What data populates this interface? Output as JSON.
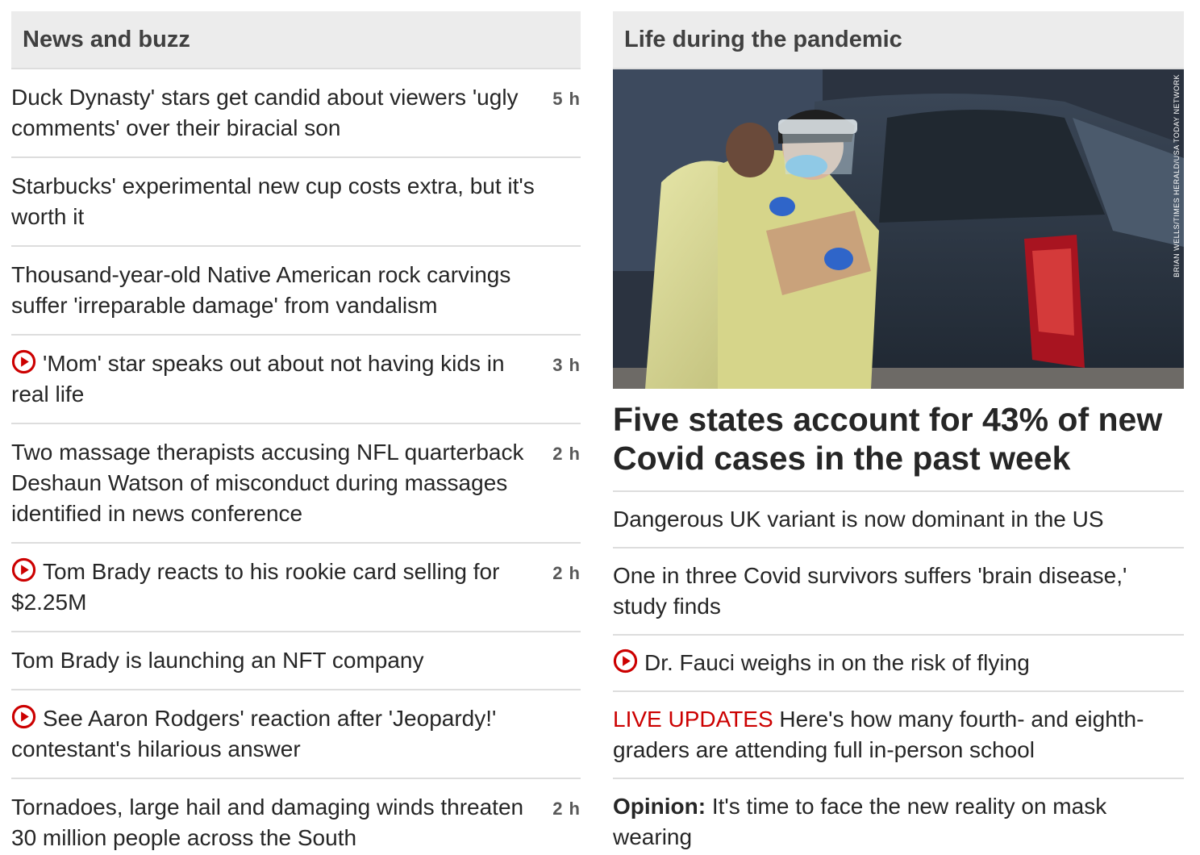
{
  "left": {
    "title": "News and buzz",
    "items": [
      {
        "text": "Duck Dynasty' stars get candid about viewers 'ugly comments' over their biracial son",
        "time": "5 h",
        "video": false
      },
      {
        "text": "Starbucks' experimental new cup costs extra, but it's worth it",
        "time": "",
        "video": false
      },
      {
        "text": "Thousand-year-old Native American rock carvings suffer 'irreparable damage' from vandalism",
        "time": "",
        "video": false
      },
      {
        "text": "'Mom' star speaks out about not having kids in real life",
        "time": "3 h",
        "video": true
      },
      {
        "text": "Two massage therapists accusing NFL quarterback Deshaun Watson of misconduct during massages identified in news conference",
        "time": "2 h",
        "video": false
      },
      {
        "text": "Tom Brady reacts to his rookie card selling for $2.25M",
        "time": "2 h",
        "video": true
      },
      {
        "text": "Tom Brady is launching an NFT company",
        "time": "",
        "video": false
      },
      {
        "text": "See Aaron Rodgers' reaction after 'Jeopardy!' contestant's hilarious answer",
        "time": "",
        "video": true
      },
      {
        "text": "Tornadoes, large hail and damaging winds threaten 30 million people across the South",
        "time": "2 h",
        "video": false
      }
    ]
  },
  "right": {
    "title": "Life during the pandemic",
    "photo_credit": "BRIAN WELLS/TIMES HERALD/USA TODAY NETWORK",
    "hero_headline": "Five states account for 43% of new Covid cases in the past week",
    "items": [
      {
        "text": "Dangerous UK variant is now dominant in the US"
      },
      {
        "text": "One in three Covid survivors suffers 'brain disease,' study finds"
      },
      {
        "text": "Dr. Fauci weighs in on the risk of flying",
        "video": true
      },
      {
        "prefix": "LIVE UPDATES",
        "text": " Here's how many fourth- and eighth-graders are attending full in-person school"
      },
      {
        "label": "Opinion:",
        "text": " It's time to face the new reality on mask wearing"
      }
    ]
  },
  "colors": {
    "accent_red": "#cc0000",
    "header_bg": "#ececec",
    "divider": "#dddddd"
  },
  "icons": {
    "video": "play-circle-icon"
  }
}
